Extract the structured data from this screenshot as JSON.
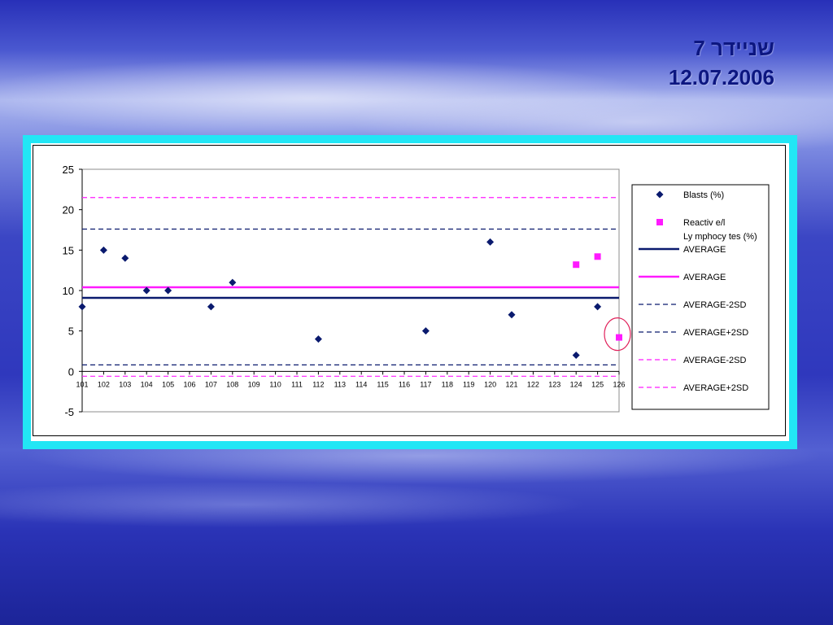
{
  "slide": {
    "title_line1": "שניידר 7",
    "title_line2": "12.07.2006"
  },
  "chart_data": {
    "type": "scatter",
    "title": "",
    "xlabel": "",
    "ylabel": "",
    "categories": [
      "101",
      "102",
      "103",
      "104",
      "105",
      "106",
      "107",
      "108",
      "109",
      "110",
      "111",
      "112",
      "113",
      "114",
      "115",
      "116",
      "117",
      "118",
      "119",
      "120",
      "121",
      "122",
      "123",
      "124",
      "125",
      "126"
    ],
    "ylim": [
      -5,
      25
    ],
    "yticks": [
      -5,
      0,
      5,
      10,
      15,
      20,
      25
    ],
    "grid": false,
    "legend_position": "right",
    "series": [
      {
        "name": "Blasts   (%)",
        "marker": "diamond",
        "color": "#0a1a6e",
        "points": [
          {
            "x": "101",
            "y": 8
          },
          {
            "x": "102",
            "y": 15
          },
          {
            "x": "103",
            "y": 14
          },
          {
            "x": "104",
            "y": 10
          },
          {
            "x": "105",
            "y": 10
          },
          {
            "x": "107",
            "y": 8
          },
          {
            "x": "108",
            "y": 11
          },
          {
            "x": "112",
            "y": 4
          },
          {
            "x": "117",
            "y": 5
          },
          {
            "x": "120",
            "y": 16
          },
          {
            "x": "121",
            "y": 7
          },
          {
            "x": "124",
            "y": 2
          },
          {
            "x": "125",
            "y": 8
          }
        ]
      },
      {
        "name": "Reactive/l Lymphocytes (%)",
        "name_lines": [
          "Reactiv e/l",
          "Ly mphocy tes  (%)"
        ],
        "marker": "square",
        "color": "#ff1aff",
        "points": [
          {
            "x": "124",
            "y": 13.2
          },
          {
            "x": "125",
            "y": 14.2
          },
          {
            "x": "126",
            "y": 4.2
          }
        ]
      }
    ],
    "reference_lines": [
      {
        "name": "AVERAGE",
        "y": 9.1,
        "color": "#0a1a6e",
        "style": "solid"
      },
      {
        "name": "AVERAGE",
        "y": 10.4,
        "color": "#ff1aff",
        "style": "solid"
      },
      {
        "name": "AVERAGE-2SD",
        "y": 0.8,
        "color": "#0a1a6e",
        "style": "dashed"
      },
      {
        "name": "AVERAGE+2SD",
        "y": 17.6,
        "color": "#0a1a6e",
        "style": "dashed"
      },
      {
        "name": "AVERAGE-2SD",
        "y": -0.6,
        "color": "#ff1aff",
        "style": "dashed"
      },
      {
        "name": "AVERAGE+2SD",
        "y": 21.5,
        "color": "#ff1aff",
        "style": "dashed"
      }
    ],
    "annotations": [
      {
        "type": "circle",
        "x": "126",
        "y": 4.2,
        "color": "#e0205a"
      }
    ]
  }
}
